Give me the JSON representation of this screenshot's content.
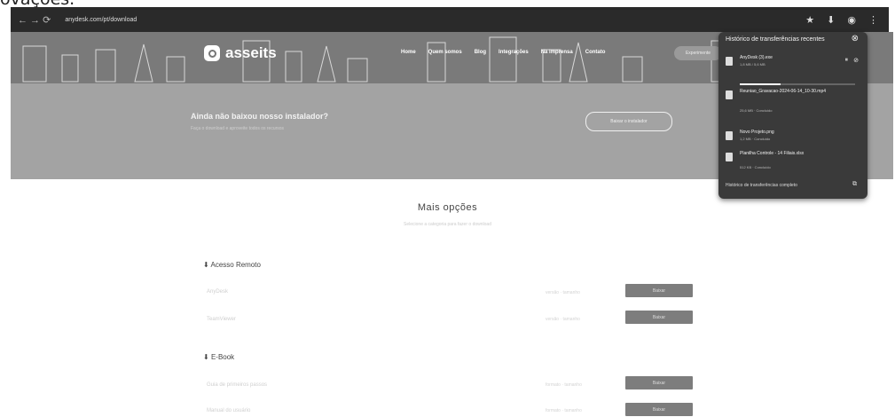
{
  "caption": "ovações.",
  "browser": {
    "nav_icons": "← → ⟳",
    "url": "anydesk.com/pt/download",
    "toolbar_icons": [
      "★",
      "⬇",
      "◉",
      "⋮"
    ]
  },
  "site": {
    "logo_text": "asseits",
    "nav": [
      "Home",
      "Quem somos",
      "Blog",
      "Integrações",
      "Na imprensa",
      "Contato"
    ],
    "cta": "Experimente",
    "banner_title": "Ainda não baixou nosso instalador?",
    "banner_subtitle": "Faça o download e aproveite todos os recursos",
    "banner_button": "Baixar o instalador"
  },
  "content": {
    "title": "Mais opções",
    "subtitle": "Selecione a categoria para fazer o download",
    "sections": [
      {
        "title": "Acesso Remoto",
        "items": [
          {
            "name": "AnyDesk",
            "meta": "versão · tamanho",
            "button": "Baixar"
          },
          {
            "name": "TeamViewer",
            "meta": "versão · tamanho",
            "button": "Baixar"
          }
        ]
      },
      {
        "title": "E-Book",
        "items": [
          {
            "name": "Guia de primeiros passos",
            "meta": "formato · tamanho",
            "button": "Baixar"
          },
          {
            "name": "Manual do usuário",
            "meta": "formato · tamanho",
            "button": "Baixar"
          }
        ]
      }
    ]
  },
  "downloads_popup": {
    "title": "Histórico de transferências recentes",
    "items": [
      {
        "name": "AnyDesk (3).exe",
        "status": "1,8 MB / 5,6 MB",
        "progress": 0.35
      },
      {
        "name": "Reuniao_Gravacao-2024-06-14_10-30.mp4",
        "status": "25,6 MB · Concluído"
      },
      {
        "name": "Novo Projeto.png",
        "status": "1,2 MB · Concluído"
      },
      {
        "name": "Planilha Controle - 14 Filiais.xlsx",
        "status": "512 KB · Concluído"
      }
    ],
    "footer": "Histórico de transferências completo",
    "colors": {
      "background": "#3a3a3a",
      "text": "#f2f2f2"
    }
  }
}
